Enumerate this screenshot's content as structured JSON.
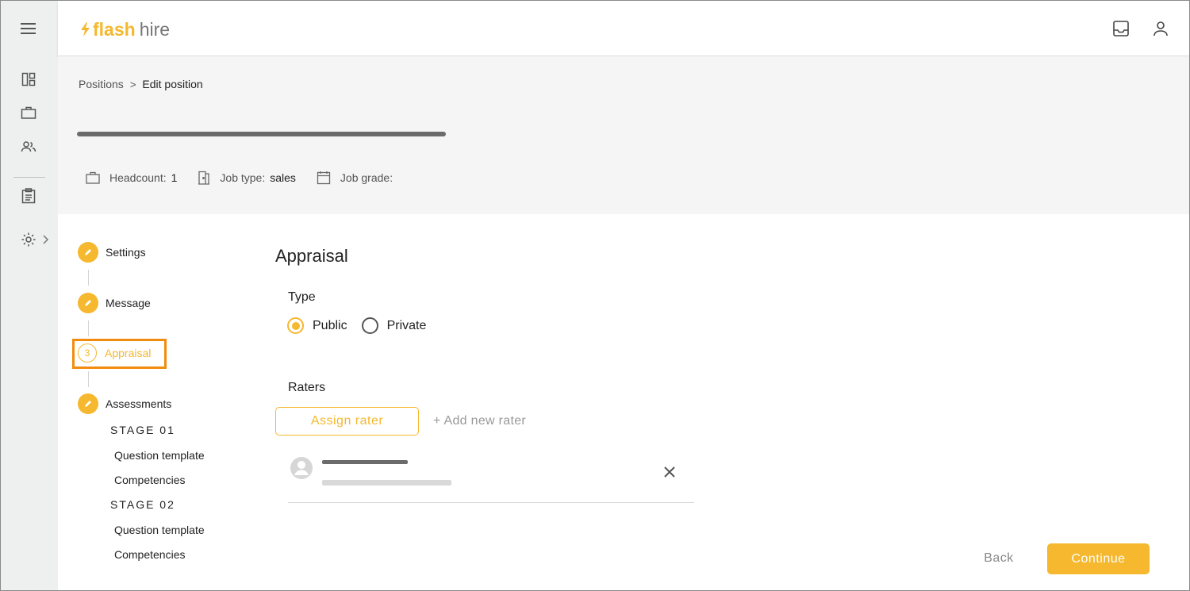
{
  "app": {
    "logo_flash": "flash",
    "logo_hire": "hire",
    "brand_color": "#f5b82e"
  },
  "rail": {
    "icons": [
      "menu-icon",
      "dashboard-icon",
      "briefcase-icon",
      "people-icon",
      "clipboard-icon",
      "gear-icon",
      "chevron-right-icon"
    ]
  },
  "header": {
    "icons": [
      "inbox-icon",
      "account-icon"
    ]
  },
  "breadcrumb": {
    "parent": "Positions",
    "separator": ">",
    "current": "Edit position"
  },
  "summary": {
    "headcount_label": "Headcount:",
    "headcount_value": "1",
    "job_type_label": "Job type:",
    "job_type_value": "sales",
    "job_grade_label": "Job grade:",
    "job_grade_value": ""
  },
  "stepper": {
    "steps": [
      {
        "label": "Settings",
        "state": "done"
      },
      {
        "label": "Message",
        "state": "done"
      },
      {
        "label": "Appraisal",
        "state": "active",
        "number": "3"
      },
      {
        "label": "Assessments",
        "state": "done"
      }
    ],
    "stages": [
      {
        "label": "STAGE 01",
        "items": [
          "Question template",
          "Competencies"
        ]
      },
      {
        "label": "STAGE 02",
        "items": [
          "Question template",
          "Competencies"
        ]
      }
    ]
  },
  "form": {
    "title": "Appraisal",
    "type_label": "Type",
    "type_options": [
      "Public",
      "Private"
    ],
    "type_selected": "Public",
    "raters_label": "Raters",
    "assign_button": "Assign rater",
    "add_new_rater": "+ Add new rater"
  },
  "footer": {
    "back_label": "Back",
    "continue_label": "Continue"
  }
}
